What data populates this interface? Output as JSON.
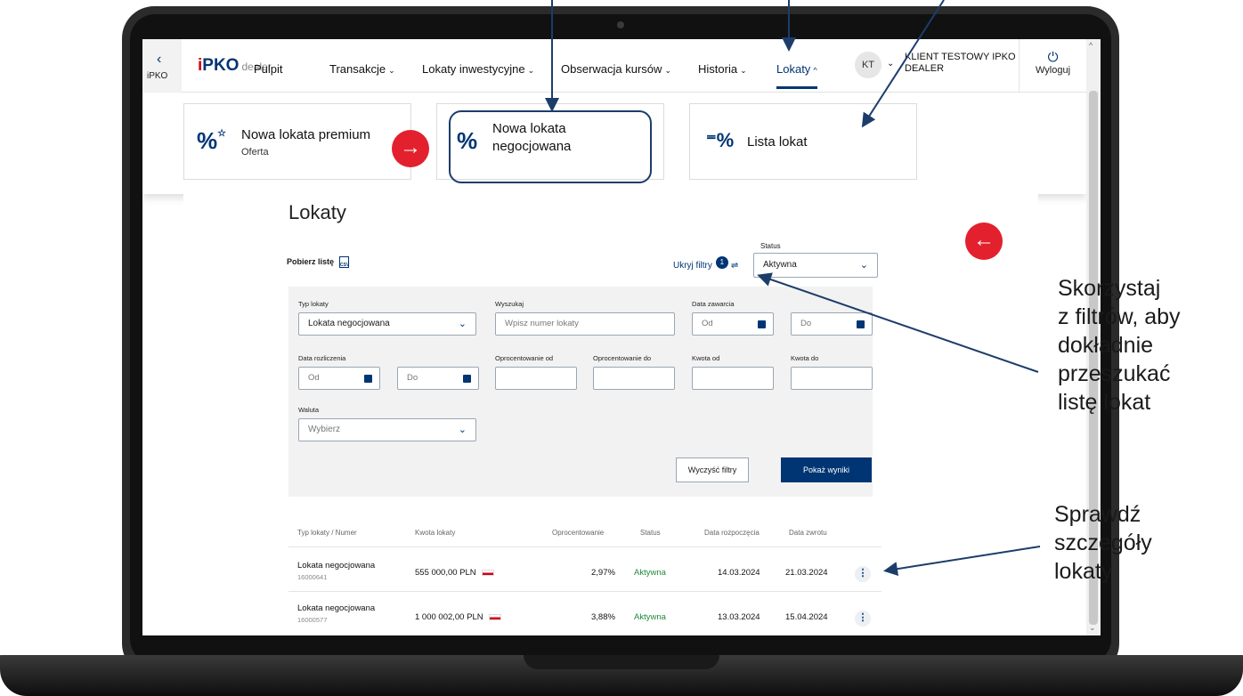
{
  "back": {
    "label": "iPKO"
  },
  "logo": {
    "brand": "PKO",
    "suffix": "dealer"
  },
  "nav": {
    "items": [
      "Pulpit",
      "Transakcje",
      "Lokaty inwestycyjne",
      "Obserwacja kursów",
      "Historia",
      "Lokaty"
    ],
    "user_initials": "KT",
    "client_name": "KLIENT TESTOWY IPKO DEALER",
    "logout_label": "Wyloguj"
  },
  "mega_menu": {
    "cards": [
      {
        "title": "Nowa lokata premium",
        "subtitle": "Oferta"
      },
      {
        "title": "Nowa lokata negocjowana",
        "subtitle": ""
      },
      {
        "title": "Lista lokat",
        "subtitle": ""
      }
    ]
  },
  "page": {
    "title": "Lokaty",
    "download_label": "Pobierz listę",
    "hide_filters_label": "Ukryj filtry",
    "filter_count": "1",
    "status_label": "Status",
    "status_value": "Aktywna"
  },
  "filters": {
    "type_label": "Typ lokaty",
    "type_value": "Lokata negocjowana",
    "search_label": "Wyszukaj",
    "search_placeholder": "Wpisz numer lokaty",
    "opened_label": "Data zawarcia",
    "settle_label": "Data rozliczenia",
    "rate_from_label": "Oprocentowanie od",
    "rate_to_label": "Oprocentowanie do",
    "amount_from_label": "Kwota od",
    "amount_to_label": "Kwota do",
    "from_ph": "Od",
    "to_ph": "Do",
    "currency_label": "Waluta",
    "currency_placeholder": "Wybierz",
    "clear_label": "Wyczyść filtry",
    "show_label": "Pokaż wyniki"
  },
  "table": {
    "headers": [
      "Typ lokaty / Numer",
      "Kwota lokaty",
      "Oprocentowanie",
      "Status",
      "Data rozpoczęcia",
      "Data zwrotu"
    ],
    "rows": [
      {
        "type": "Lokata negocjowana",
        "number": "16000641",
        "amount": "555 000,00 PLN",
        "rate": "2,97%",
        "status": "Aktywna",
        "start": "14.03.2024",
        "end": "21.03.2024"
      },
      {
        "type": "Lokata negocjowana",
        "number": "16000577",
        "amount": "1 000 002,00 PLN",
        "rate": "3,88%",
        "status": "Aktywna",
        "start": "13.03.2024",
        "end": "15.04.2024"
      }
    ]
  },
  "annotations": {
    "filters_hint": [
      "Skorzystaj",
      "z filtrów, aby",
      "dokładnie",
      "przeszukać",
      "listę lokat"
    ],
    "details_hint": [
      "Sprawdź",
      "szczegóły",
      "lokaty"
    ]
  },
  "colors": {
    "brand": "#003574",
    "accent_red": "#e3202d",
    "active_status": "#1e8a3a"
  }
}
